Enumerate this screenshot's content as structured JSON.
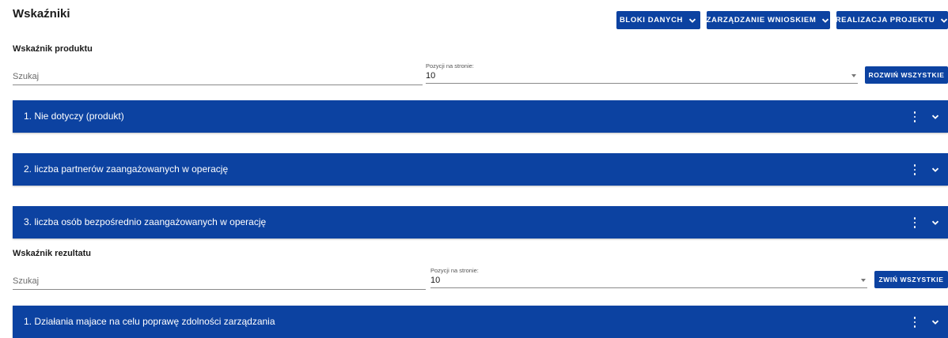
{
  "page": {
    "title": "Wskaźniki"
  },
  "toolbar": {
    "buttons": [
      {
        "label": "BLOKI DANYCH"
      },
      {
        "label": "ZARZĄDZANIE WNIOSKIEM"
      },
      {
        "label": "REALIZACJA PROJEKTU"
      }
    ]
  },
  "product_section": {
    "title": "Wskaźnik produktu",
    "search_placeholder": "Szukaj",
    "per_page_label": "Pozycji na stronie:",
    "per_page_value": "10",
    "toggle_label": "ROZWIŃ WSZYSTKIE",
    "items": [
      {
        "title": "1. Nie dotyczy (produkt)"
      },
      {
        "title": "2. liczba partnerów zaangażowanych w operację"
      },
      {
        "title": "3. liczba osób bezpośrednio zaangażowanych w operację"
      }
    ]
  },
  "result_section": {
    "title": "Wskaźnik rezultatu",
    "search_placeholder": "Szukaj",
    "per_page_label": "Pozycji na stronie:",
    "per_page_value": "10",
    "toggle_label": "ZWIŃ WSZYSTKIE",
    "items": [
      {
        "title": "1. Działania majace na celu poprawę zdolności zarządzania"
      }
    ]
  },
  "icons": {
    "button_chevron": "chevron-down-icon",
    "panel_menu": "more-vertical-icon",
    "panel_toggle": "chevron-down-icon"
  },
  "colors": {
    "primary": "#0c42a1",
    "text": "#1b1b1b",
    "background": "#ffffff"
  }
}
